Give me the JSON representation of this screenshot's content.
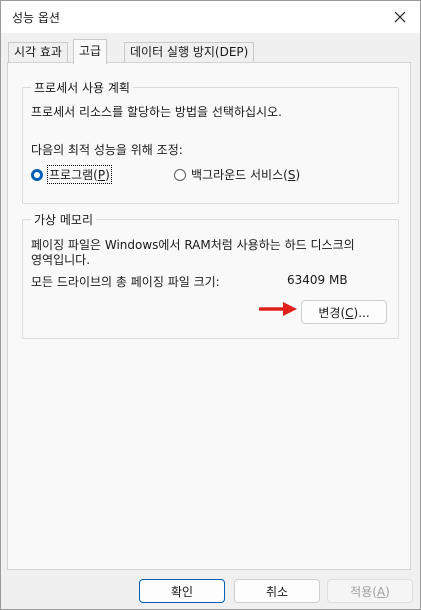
{
  "window": {
    "title": "성능 옵션"
  },
  "tabs": [
    {
      "label": "시각 효과",
      "active": false
    },
    {
      "label": "고급",
      "active": true
    },
    {
      "label": "데이터 실행 방지(DEP)",
      "active": false
    }
  ],
  "processor": {
    "legend": "프로세서 사용 계획",
    "description": "프로세서 리소스를 할당하는 방법을 선택하십시오.",
    "adjust_label": "다음의 최적 성능을 위해 조정:",
    "options": [
      {
        "text": "프로그램(",
        "key": "P",
        "tail": ")",
        "checked": true
      },
      {
        "text": "백그라운드 서비스(",
        "key": "S",
        "tail": ")",
        "checked": false
      }
    ]
  },
  "virtual_memory": {
    "legend": "가상 메모리",
    "description_line1": "페이징 파일은 Windows에서 RAM처럼 사용하는 하드 디스크의",
    "description_line2": "영역입니다.",
    "total_label": "모든 드라이브의 총 페이징 파일 크기:",
    "total_value": "63409 MB",
    "change_button": {
      "text": "변경(",
      "key": "C",
      "tail": ")..."
    }
  },
  "footer": {
    "ok": "확인",
    "cancel": "취소",
    "apply": {
      "text": "적용(",
      "key": "A",
      "tail": ")"
    }
  },
  "colors": {
    "accent": "#005fb8",
    "annotation_arrow": "#e0201b"
  },
  "icons": {
    "close": "close-icon",
    "arrow": "arrow-right-icon"
  }
}
